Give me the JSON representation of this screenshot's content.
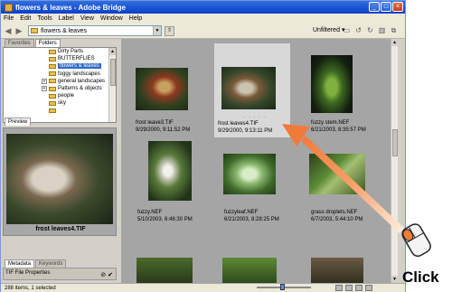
{
  "window": {
    "title": "flowers & leaves - Adobe Bridge"
  },
  "window_controls": [
    "_",
    "□",
    "×"
  ],
  "menu": [
    "File",
    "Edit",
    "Tools",
    "Label",
    "View",
    "Window",
    "Help"
  ],
  "toolbar": {
    "path": "flowers & leaves",
    "filter": "Unfiltered"
  },
  "left_tabs": [
    "Favorites",
    "Folders"
  ],
  "tree": [
    {
      "label": "Dirty Parts",
      "exp": false,
      "sel": false
    },
    {
      "label": "BUTTERFLIES",
      "exp": false,
      "sel": false
    },
    {
      "label": "flowers & leaves",
      "exp": false,
      "sel": true
    },
    {
      "label": "foggy landscapes",
      "exp": false,
      "sel": false
    },
    {
      "label": "general landscapes",
      "exp": true,
      "sel": false
    },
    {
      "label": "Patterns & objects",
      "exp": true,
      "sel": false
    },
    {
      "label": "people",
      "exp": false,
      "sel": false
    },
    {
      "label": "sky",
      "exp": false,
      "sel": false
    },
    {
      "label": "",
      "exp": false,
      "sel": false
    }
  ],
  "preview": {
    "tab": "Preview",
    "caption": "frost leaves4.TIF"
  },
  "meta_tabs": [
    "Metadata",
    "Keywords"
  ],
  "meta": {
    "section": "TIF File Properties"
  },
  "thumbnails": [
    {
      "name": "frost leave3.TIF",
      "date": "9/29/2000, 9:11:52 PM",
      "selected": false
    },
    {
      "name": "frost leaves4.TIF",
      "date": "9/29/2000, 9:13:11 PM",
      "selected": true
    },
    {
      "name": "fuzzy stem.NEF",
      "date": "6/21/2003, 8:35:57 PM",
      "selected": false
    },
    {
      "name": "fuzzy.NEF",
      "date": "5/10/2003, 6:46:30 PM",
      "selected": false
    },
    {
      "name": "fuzzyleaf.NEF",
      "date": "6/21/2003, 8:28:25 PM",
      "selected": false
    },
    {
      "name": "grass droplets.NEF",
      "date": "6/7/2003, 5:44:10 PM",
      "selected": false
    }
  ],
  "selected_dots": ". . . . .",
  "status": "288 items, 1 selected",
  "callout": {
    "label": "Click"
  },
  "colors": {
    "titlebar": "#0a3fc8",
    "selection": "#316ac5",
    "arrow": "#f07a3a",
    "content_bg": "#a5a5a5"
  }
}
